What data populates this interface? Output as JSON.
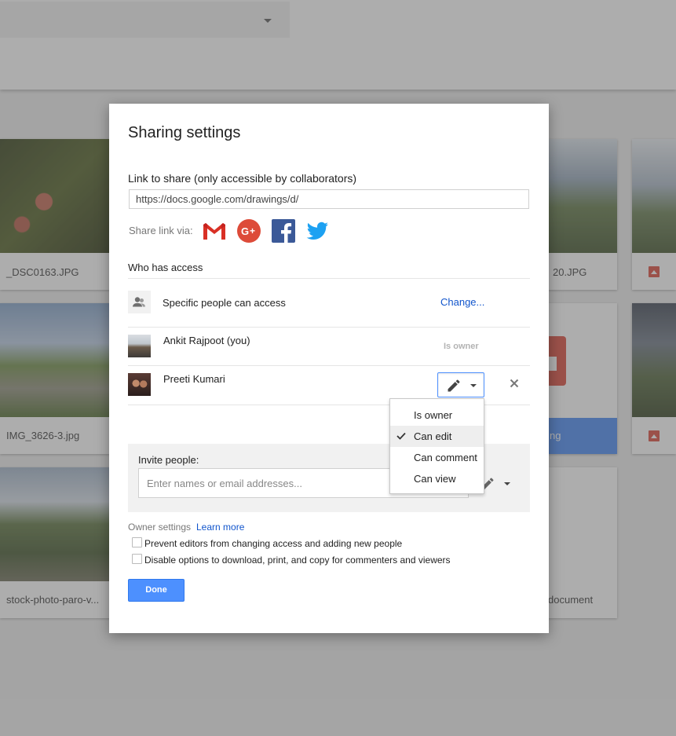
{
  "background": {
    "tiles": [
      {
        "name": "_DSC0163.JPG"
      },
      {
        "name": "IMG_3626-3.jpg"
      },
      {
        "name": "stock-photo-paro-v..."
      },
      {
        "name": "20.JPG"
      },
      {
        "name": "ng"
      },
      {
        "name": "document"
      }
    ]
  },
  "dialog": {
    "title": "Sharing settings",
    "link_label": "Link to share (only accessible by collaborators)",
    "link_value": "https://docs.google.com/drawings/d/",
    "share_via_label": "Share link via:",
    "share_icons": [
      "gmail-icon",
      "google-plus-icon",
      "facebook-icon",
      "twitter-icon"
    ],
    "who_has_access": "Who has access",
    "access": {
      "text": "Specific people can access",
      "change_label": "Change..."
    },
    "people": [
      {
        "name": "Ankit Rajpoot (you)",
        "role": "Is owner"
      },
      {
        "name": "Preeti Kumari",
        "role_icon": "pencil-icon"
      }
    ],
    "invite": {
      "label": "Invite people:",
      "placeholder": "Enter names or email addresses..."
    },
    "owner_settings": {
      "label": "Owner settings",
      "learn_more": "Learn more",
      "options": [
        {
          "label": "Prevent editors from changing access and adding new people",
          "checked": false
        },
        {
          "label": "Disable options to download, print, and copy for commenters and viewers",
          "checked": false
        }
      ]
    },
    "done_label": "Done"
  },
  "permission_menu": {
    "items": [
      {
        "label": "Is owner",
        "selected": false
      },
      {
        "label": "Can edit",
        "selected": true
      },
      {
        "label": "Can comment",
        "selected": false
      },
      {
        "label": "Can view",
        "selected": false
      }
    ]
  },
  "colors": {
    "accent": "#4d90fe",
    "link": "#1155cc"
  }
}
